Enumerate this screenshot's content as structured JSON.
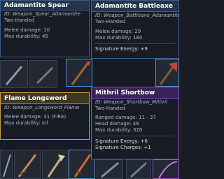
{
  "tooltips": {
    "spear": {
      "name": "Adamantite Spear",
      "id": "ID: Weapon_Spear_Adamantite",
      "hands": "Two-Handed",
      "stats": [
        "Melee damage: 10",
        "Max durability: 45"
      ]
    },
    "battleaxe": {
      "name": "Adamantite Battleaxe",
      "id": "ID: Weapon_Battleaxe_Adamantite",
      "hands": "Two-Handed",
      "stats": [
        "Melee damage: 29",
        "Max durability: 180"
      ],
      "signature": "Signature Energy: +9"
    },
    "longsword": {
      "name": "Flame Longsword",
      "id": "ID: Weapon_Longsword_Flame",
      "stats": [
        "Melee damage: 31 (FIRE)",
        "Max durability: inf"
      ]
    },
    "shortbow": {
      "name": "Mithril Shortbow",
      "id": "ID: Weapon_Shortbow_Mithril",
      "hands": "Two-Handed",
      "stats": [
        "Ranged damage: 11 - 37",
        "Head damage: 48",
        "Max durability: 320"
      ],
      "signature": [
        "Signature Energy: +6",
        "Signature Charges: +1"
      ]
    }
  },
  "colors": {
    "blue_header": "#23344c",
    "gold_border": "#c89a3e",
    "purple_border": "#8a4ec9"
  },
  "icons": [
    "spear-icon",
    "battleaxe-icon",
    "longsword-icon",
    "shortbow-icon",
    "weapon-icon"
  ]
}
